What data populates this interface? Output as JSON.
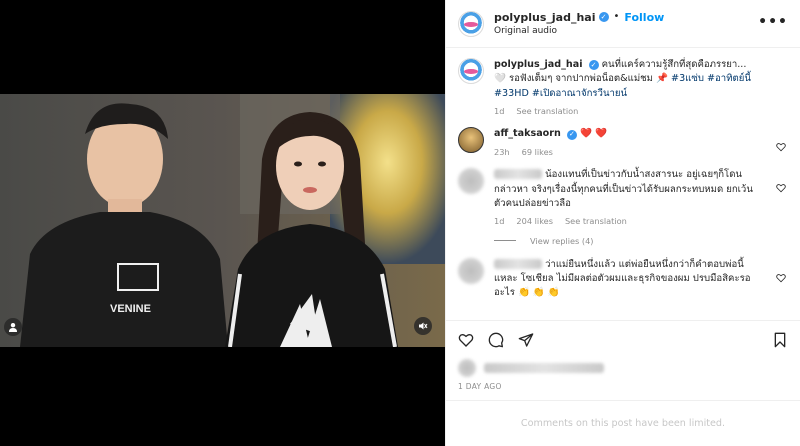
{
  "post": {
    "username": "polyplus_jad_hai",
    "follow_label": "Follow",
    "audio_label": "Original audio",
    "more_label": "•••"
  },
  "comments": [
    {
      "username": "polyplus_jad_hai",
      "text_prefix": "คนที่แคร์ความรู้สึกที่สุดคือภรรยา... 🤍 รอฟังเต็มๆ จากปากพ่อน็อต&แม่ชม 📌 ",
      "hashtags": "#3แซ่บ #อาทิตย์นี้ #33HD #เปิดอาณาจักรวีนายน์",
      "time": "1d",
      "see_translation": "See translation"
    },
    {
      "username": "aff_taksaorn",
      "text": "❤️ ❤️",
      "time": "23h",
      "likes": "69 likes"
    },
    {
      "text": "น้องแทนที่เป็นข่าวกับน้ำสงสารนะ อยู่เฉยๆก็โดนกล่าวหา จริงๆเรื่องนี้ทุกคนที่เป็นข่าวได้รับผลกระทบหมด ยกเว้นตัวคนปล่อยข่าวลือ",
      "time": "1d",
      "likes": "204 likes",
      "see_translation": "See translation",
      "view_replies": "View replies (4)"
    },
    {
      "text": "ว่าแม่ยืนหนึ่งแล้ว แต่พ่อยืนหนึ่งกว่าก็คำตอบพ่อนี้แหละ โซเชียล ไม่มีผลต่อตัวผมและธุรกิจของผม ปรบมือสิคะรออะไร 👏 👏 👏"
    }
  ],
  "post_footer": {
    "date": "1 DAY AGO",
    "comments_limited": "Comments on this post have been limited."
  },
  "video": {
    "shirt_brand": "VENINE"
  }
}
